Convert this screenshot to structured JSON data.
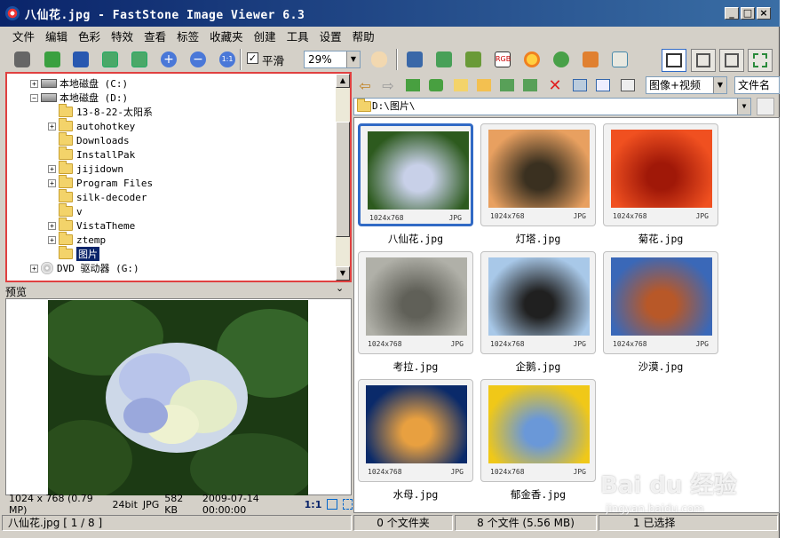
{
  "window": {
    "title": "八仙花.jpg  -  FastStone Image Viewer 6.3"
  },
  "menu": [
    "文件",
    "编辑",
    "色彩",
    "特效",
    "查看",
    "标签",
    "收藏夹",
    "创建",
    "工具",
    "设置",
    "帮助"
  ],
  "toolbar": {
    "smooth_label": "平滑",
    "smooth_checked": "✓",
    "zoom_value": "29%"
  },
  "tree": {
    "items": [
      {
        "label": "本地磁盘 (C:)",
        "type": "drive",
        "expander": "+"
      },
      {
        "label": "本地磁盘 (D:)",
        "type": "drive",
        "expander": "−"
      },
      {
        "label": "13-8-22-太阳系",
        "type": "folder",
        "expander": ""
      },
      {
        "label": "autohotkey",
        "type": "folder",
        "expander": "+"
      },
      {
        "label": "Downloads",
        "type": "folder",
        "expander": ""
      },
      {
        "label": "InstallPak",
        "type": "folder",
        "expander": ""
      },
      {
        "label": "jijidown",
        "type": "folder",
        "expander": "+"
      },
      {
        "label": "Program Files",
        "type": "folder",
        "expander": "+"
      },
      {
        "label": "silk-decoder",
        "type": "folder",
        "expander": ""
      },
      {
        "label": "v",
        "type": "folder",
        "expander": ""
      },
      {
        "label": "VistaTheme",
        "type": "folder",
        "expander": "+"
      },
      {
        "label": "ztemp",
        "type": "folder",
        "expander": "+"
      },
      {
        "label": "图片",
        "type": "folder",
        "expander": "",
        "selected": true
      },
      {
        "label": "DVD 驱动器 (G:)",
        "type": "dvd",
        "expander": "+"
      }
    ]
  },
  "preview": {
    "header": "预览",
    "chevron": "⌄"
  },
  "image_info": {
    "dims": "1024 x 768 (0.79 MP)",
    "bits": "24bit",
    "format": "JPG",
    "size": "582 KB",
    "date": "2009-07-14 00:00:00",
    "ratio": "1:1"
  },
  "browser": {
    "filter": "图像+视频",
    "sort": "文件名",
    "path": "D:\\图片\\"
  },
  "thumbs": [
    {
      "name": "八仙花.jpg",
      "dims": "1024x768",
      "fmt": "JPG",
      "selected": true,
      "colors": [
        "#2d5a1e",
        "#c8d0e8"
      ]
    },
    {
      "name": "灯塔.jpg",
      "dims": "1024x768",
      "fmt": "JPG",
      "colors": [
        "#e8a060",
        "#3a3020"
      ]
    },
    {
      "name": "菊花.jpg",
      "dims": "1024x768",
      "fmt": "JPG",
      "colors": [
        "#f05020",
        "#a01808"
      ]
    },
    {
      "name": "考拉.jpg",
      "dims": "1024x768",
      "fmt": "JPG",
      "colors": [
        "#b0b0a8",
        "#606058"
      ]
    },
    {
      "name": "企鹅.jpg",
      "dims": "1024x768",
      "fmt": "JPG",
      "colors": [
        "#a8c8e8",
        "#202020"
      ]
    },
    {
      "name": "沙漠.jpg",
      "dims": "1024x768",
      "fmt": "JPG",
      "colors": [
        "#3a68b8",
        "#b85828"
      ]
    },
    {
      "name": "水母.jpg",
      "dims": "1024x768",
      "fmt": "JPG",
      "colors": [
        "#0a2a6a",
        "#e8a040"
      ]
    },
    {
      "name": "郁金香.jpg",
      "dims": "1024x768",
      "fmt": "JPG",
      "colors": [
        "#f0c818",
        "#6a98d8"
      ]
    }
  ],
  "status": {
    "file": "八仙花.jpg [ 1 / 8 ]",
    "folders": "0 个文件夹",
    "files": "8 个文件 (5.56 MB)",
    "selected": "1 已选择"
  },
  "watermark": {
    "logo": "Bai du 经验",
    "url": "jingyan.baidu.com"
  }
}
